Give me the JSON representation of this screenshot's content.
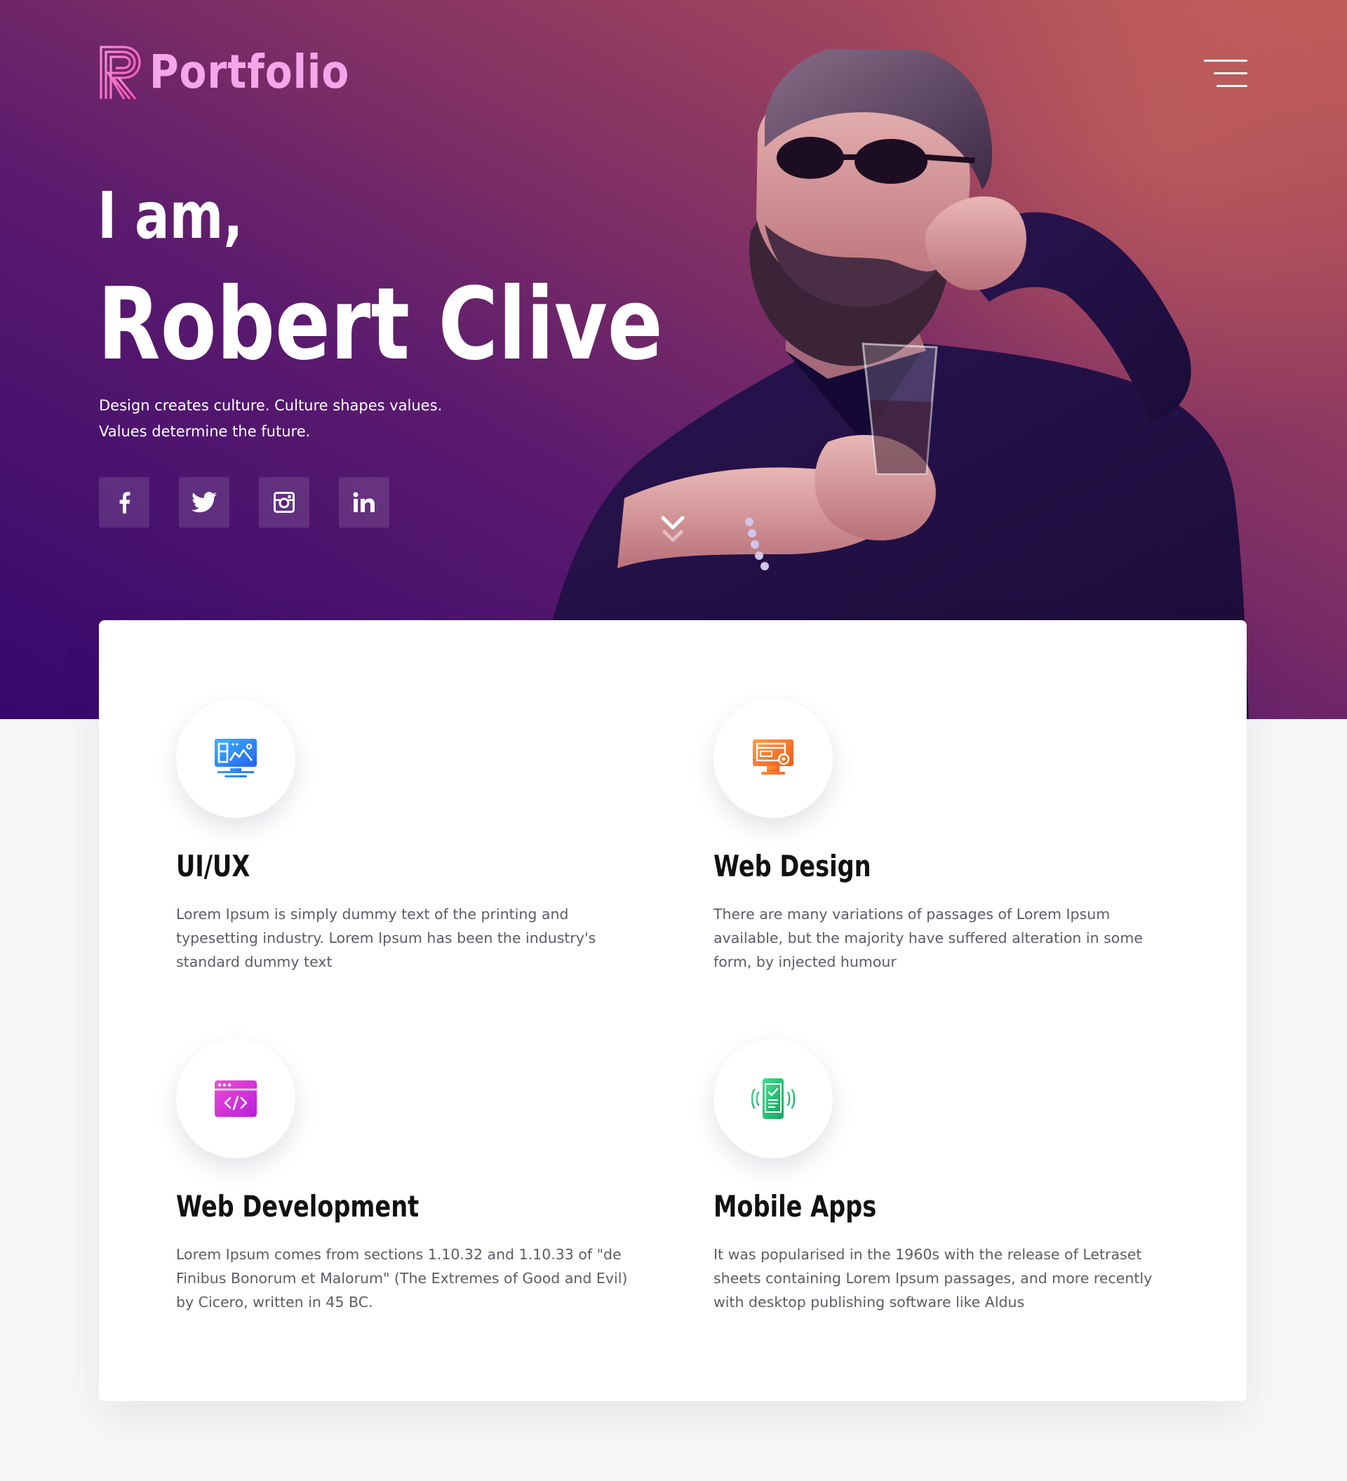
{
  "brand": {
    "logo_letter": "R",
    "name": "Portfolio"
  },
  "header": {
    "menu_icon": "hamburger-icon"
  },
  "hero": {
    "greeting": "I am,",
    "name": "Robert Clive",
    "tagline_line1": "Design creates culture. Culture shapes values.",
    "tagline_line2": "Values determine the future.",
    "social": [
      {
        "name": "facebook",
        "icon": "facebook-icon"
      },
      {
        "name": "twitter",
        "icon": "twitter-icon"
      },
      {
        "name": "instagram",
        "icon": "instagram-icon"
      },
      {
        "name": "linkedin",
        "icon": "linkedin-icon"
      }
    ],
    "scroll_icon": "double-chevron-down-icon"
  },
  "services": [
    {
      "title": "UI/UX",
      "description": "Lorem Ipsum is simply dummy text of the printing and typesetting industry. Lorem Ipsum has been the industry's standard dummy text",
      "icon": "monitor-layout-icon",
      "color": "#2e86f5"
    },
    {
      "title": "Web Design",
      "description": "There are many variations of passages of Lorem Ipsum available, but the majority have suffered alteration in some form, by injected humour",
      "icon": "monitor-gear-icon",
      "color": "#f6772c"
    },
    {
      "title": "Web Development",
      "description": "Lorem Ipsum comes from sections 1.10.32 and 1.10.33 of \"de Finibus Bonorum et Malorum\" (The Extremes of Good and Evil) by Cicero, written in 45 BC.",
      "icon": "code-window-icon",
      "color": "#d92fd0"
    },
    {
      "title": "Mobile Apps",
      "description": "It was popularised in the 1960s with the release of Letraset sheets containing Lorem Ipsum passages, and more recently with desktop publishing software like Aldus",
      "icon": "smartphone-vibrate-icon",
      "color": "#2ec77a"
    }
  ],
  "colors": {
    "hero_gradient_start": "#36086e",
    "hero_gradient_end": "#bd5a58",
    "logo_pink": "#f3a7ea",
    "page_bg": "#f7f7f8"
  }
}
